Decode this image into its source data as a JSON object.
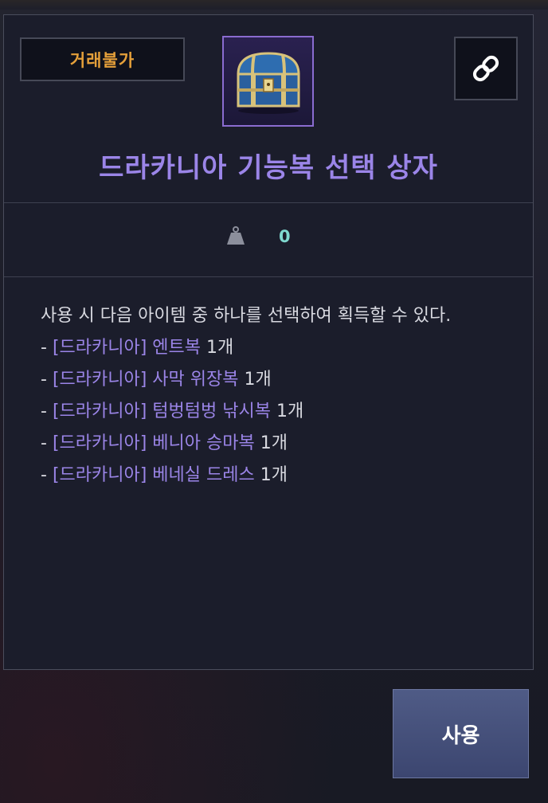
{
  "item": {
    "trade_status": "거래불가",
    "title": "드라카니아 기능복 선택 상자",
    "weight": "0"
  },
  "description": {
    "intro": "사용 시 다음 아이템 중 하나를 선택하여 획득할 수 있다.",
    "entries": [
      {
        "prefix": "- ",
        "name": "[드라카니아] 엔트복",
        "qty": "1개"
      },
      {
        "prefix": "- ",
        "name": "[드라카니아] 사막 위장복",
        "qty": "1개"
      },
      {
        "prefix": "- ",
        "name": "[드라카니아] 텀벙텀벙 낚시복",
        "qty": "1개"
      },
      {
        "prefix": "- ",
        "name": "[드라카니아] 베니아 승마복",
        "qty": "1개"
      },
      {
        "prefix": "- ",
        "name": "[드라카니아] 베네실 드레스",
        "qty": "1개"
      }
    ]
  },
  "actions": {
    "use_label": "사용"
  },
  "icons": {
    "item": "treasure-chest-icon",
    "link": "link-icon",
    "weight": "weight-icon"
  },
  "colors": {
    "trade_status": "#e5a03a",
    "title": "#9b85e8",
    "weight_value": "#7fd8cf",
    "use_button": "#4a5580"
  }
}
